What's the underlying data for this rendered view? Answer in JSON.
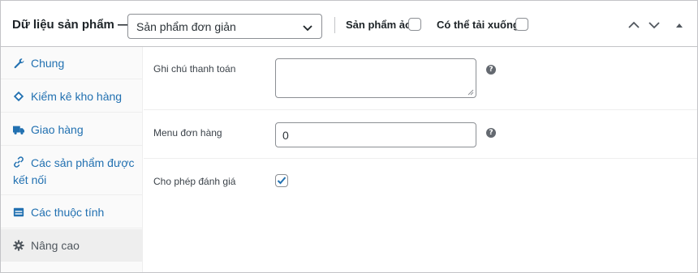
{
  "header": {
    "title": "Dữ liệu sản phẩm —",
    "product_type": "Sản phẩm đơn giản",
    "virtual_label": "Sản phẩm ảo:",
    "virtual_checked": false,
    "downloadable_label": "Có thể tải xuống:",
    "downloadable_checked": false
  },
  "sidebar": {
    "items": [
      {
        "label": "Chung",
        "icon": "wrench-icon"
      },
      {
        "label": "Kiểm kê kho hàng",
        "icon": "tag-icon"
      },
      {
        "label": "Giao hàng",
        "icon": "truck-icon"
      },
      {
        "label": "Các sản phẩm được",
        "label2": "kết nối",
        "icon": "link-icon"
      },
      {
        "label": "Các thuộc tính",
        "icon": "table-icon"
      },
      {
        "label": "Nâng cao",
        "icon": "gear-icon"
      }
    ],
    "active": "Nâng cao"
  },
  "main": {
    "purchase_note_label": "Ghi chú thanh toán",
    "purchase_note_value": "",
    "menu_order_label": "Menu đơn hàng",
    "menu_order_value": "0",
    "reviews_label": "Cho phép đánh giá",
    "reviews_checked": true
  },
  "colors": {
    "link": "#2271b1",
    "border": "#c3c4c7",
    "active_tab_bg": "#eeeeee",
    "checkmark": "#2271b1"
  }
}
